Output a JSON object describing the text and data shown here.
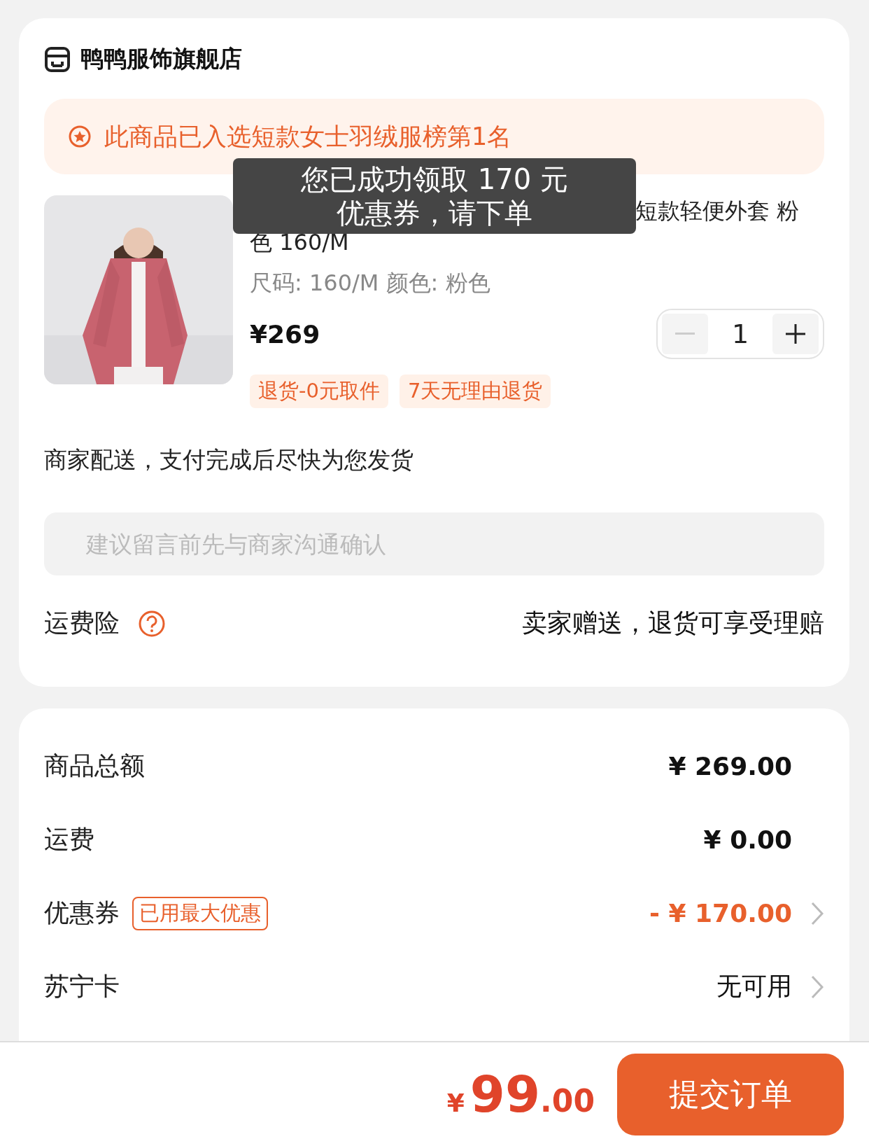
{
  "store": {
    "name": "鸭鸭服饰旗舰店"
  },
  "rank_banner": {
    "text": "此商品已入选短款女士羽绒服榜第1名"
  },
  "product": {
    "title_lines": [
      "短款轻便外套 粉",
      "色 160/M"
    ],
    "spec": "尺码: 160/M 颜色: 粉色",
    "price": "¥269",
    "quantity": "1",
    "minus_disabled": true,
    "tags": [
      "退货-0元取件",
      "7天无理由退货"
    ]
  },
  "delivery": "商家配送，支付完成后尽快为您发货",
  "message_field": {
    "placeholder": "建议留言前先与商家沟通确认"
  },
  "insurance": {
    "label": "运费险",
    "value": "卖家赠送，退货可享受理赔"
  },
  "summary_rows": [
    {
      "label": "商品总额",
      "value": "¥ 269.00",
      "highlight": false,
      "arrow": false
    },
    {
      "label": "运费",
      "value": "¥ 0.00",
      "highlight": false,
      "arrow": false
    },
    {
      "label": "优惠券",
      "badge": "已用最大优惠",
      "value": "- ¥ 170.00",
      "highlight": true,
      "arrow": true
    },
    {
      "label": "苏宁卡",
      "value": "无可用",
      "highlight": false,
      "arrow": true
    }
  ],
  "footer": {
    "currency": "¥",
    "integer": "99",
    "decimal": ".00",
    "submit": "提交订单"
  },
  "toast": {
    "lines": [
      "您已成功领取 170 元",
      "优惠券，请下单"
    ]
  }
}
